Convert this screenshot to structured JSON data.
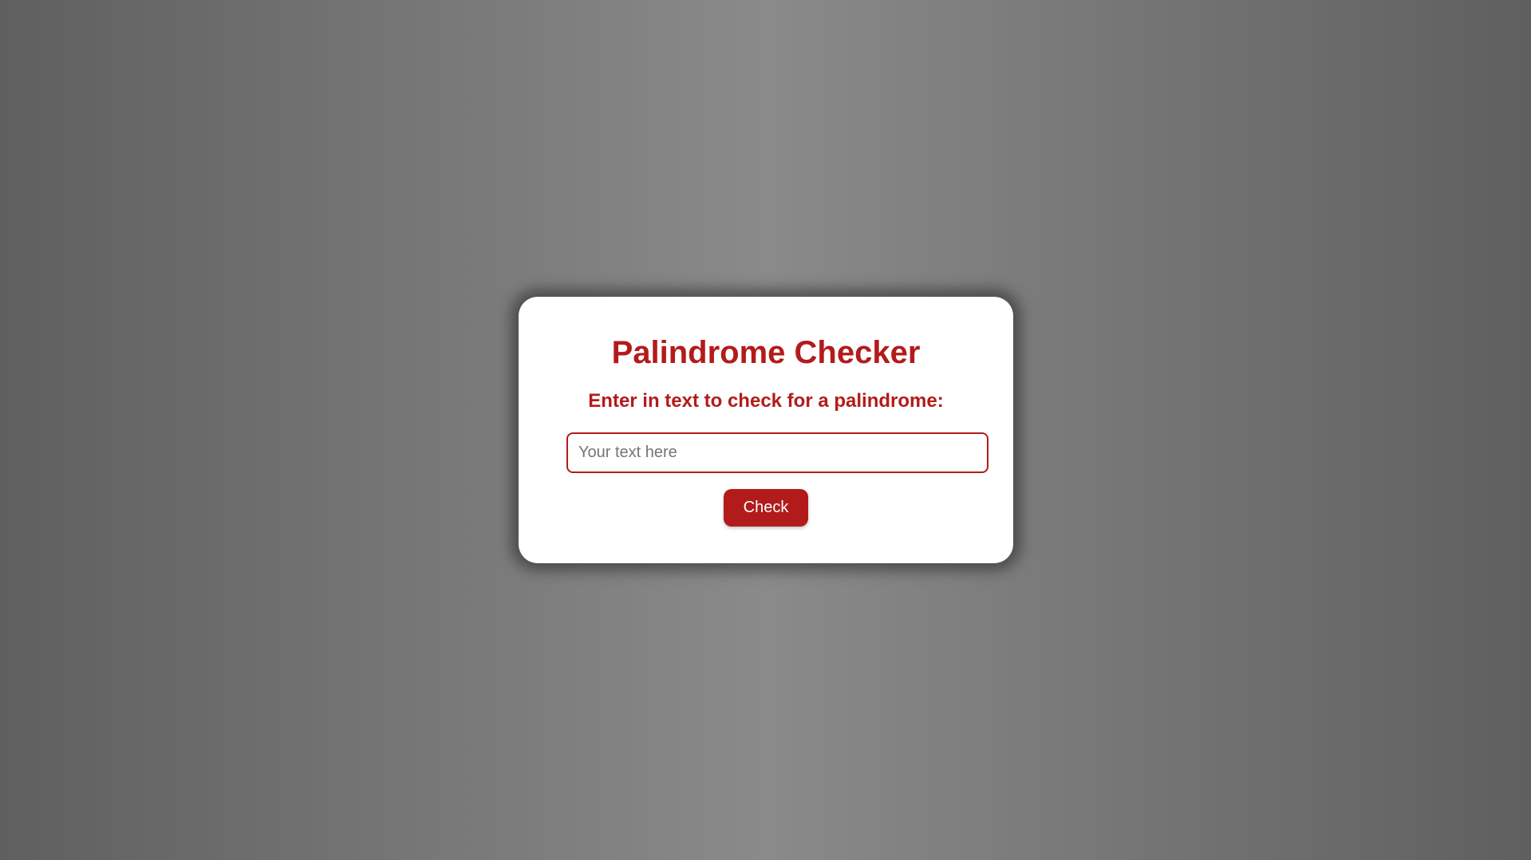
{
  "card": {
    "title": "Palindrome Checker",
    "subtitle": "Enter in text to check for a palindrome:",
    "input": {
      "value": "",
      "placeholder": "Your text here"
    },
    "button_label": "Check"
  },
  "colors": {
    "accent": "#b31b1b",
    "card_background": "#ffffff",
    "page_background": "#808080"
  }
}
